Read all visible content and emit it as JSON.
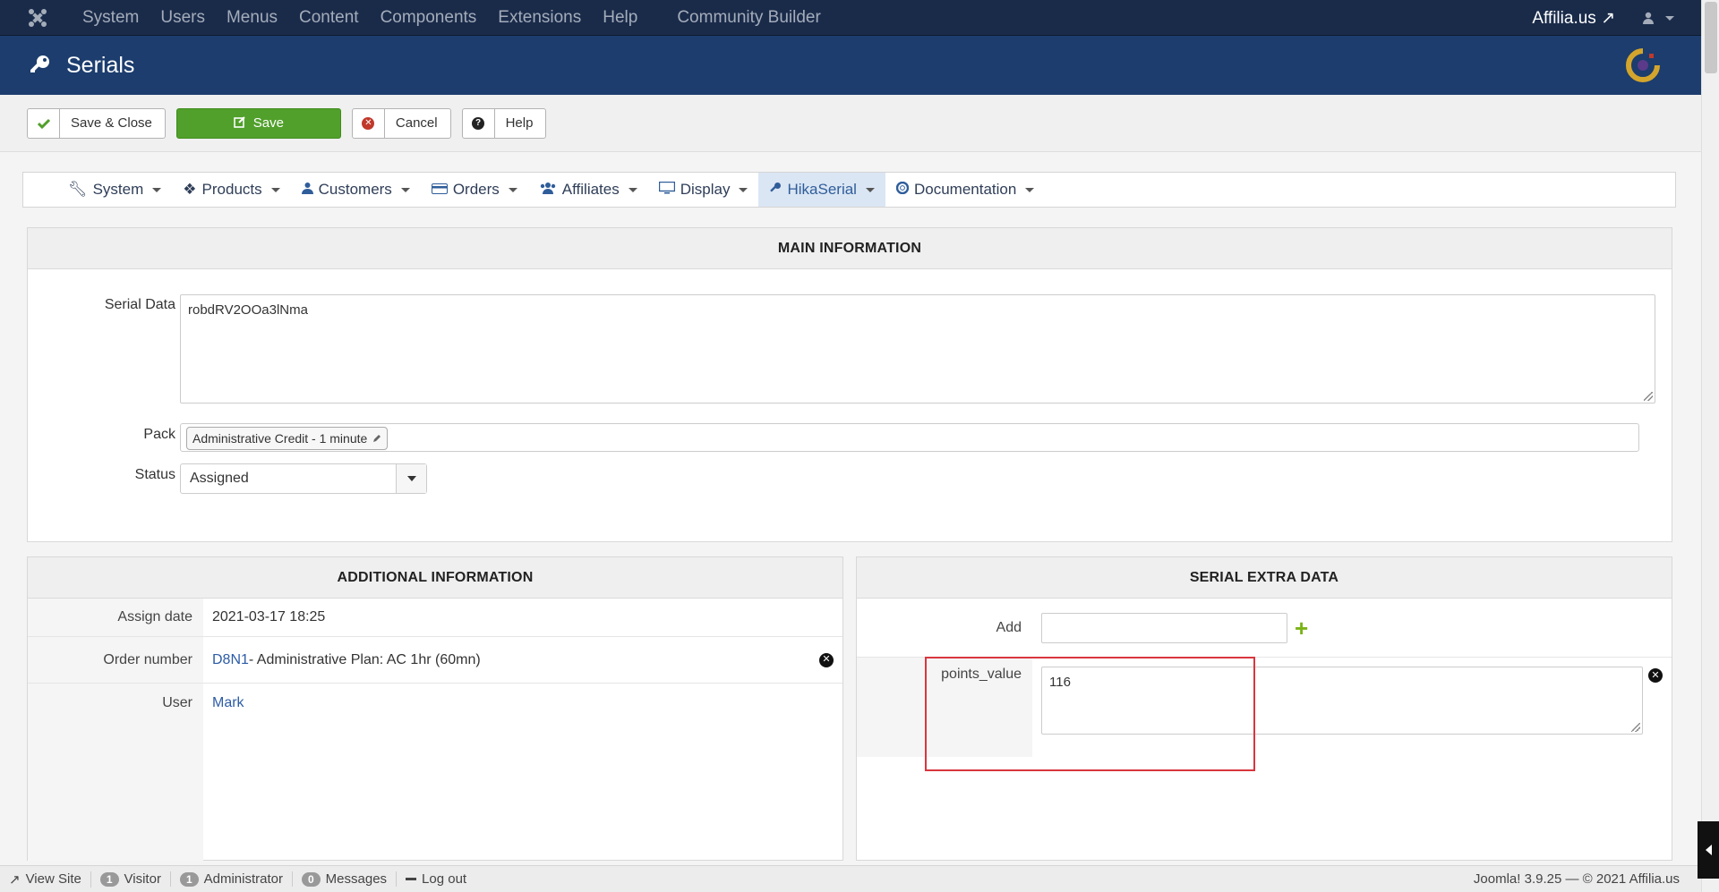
{
  "topbar": {
    "menu": [
      "System",
      "Users",
      "Menus",
      "Content",
      "Components",
      "Extensions",
      "Help"
    ],
    "community": "Community Builder",
    "site_link": "Affilia.us"
  },
  "header": {
    "title": "Serials"
  },
  "toolbar": {
    "save_close": "Save & Close",
    "save": "Save",
    "cancel": "Cancel",
    "help": "Help"
  },
  "hikanav": {
    "items": [
      "System",
      "Products",
      "Customers",
      "Orders",
      "Affiliates",
      "Display",
      "HikaSerial",
      "Documentation"
    ],
    "active": "HikaSerial"
  },
  "main": {
    "title": "MAIN INFORMATION",
    "serial_data_label": "Serial Data",
    "serial_data_value": "robdRV2OOa3lNma",
    "pack_label": "Pack",
    "pack_value": "Administrative Credit - 1 minute",
    "status_label": "Status",
    "status_value": "Assigned"
  },
  "additional": {
    "title": "ADDITIONAL INFORMATION",
    "assign_date_label": "Assign date",
    "assign_date_value": "2021-03-17 18:25",
    "order_label": "Order number",
    "order_link": "D8N1",
    "order_desc": " - Administrative Plan: AC 1hr (60mn)",
    "user_label": "User",
    "user_value": "Mark"
  },
  "extra": {
    "title": "SERIAL EXTRA DATA",
    "add_label": "Add",
    "field_name": "points_value",
    "field_value": "116"
  },
  "statusbar": {
    "view_site": "View Site",
    "visitor_count": "1",
    "visitor": "Visitor",
    "admin_count": "1",
    "administrator": "Administrator",
    "messages_count": "0",
    "messages": "Messages",
    "logout": "Log out",
    "version": "Joomla! 3.9.25  —  © 2021 Affilia.us"
  },
  "colors": {
    "topbar": "#1a2b4a",
    "header": "#1c3d6e",
    "save_green": "#51a02b",
    "highlight_red": "#d9363e"
  }
}
